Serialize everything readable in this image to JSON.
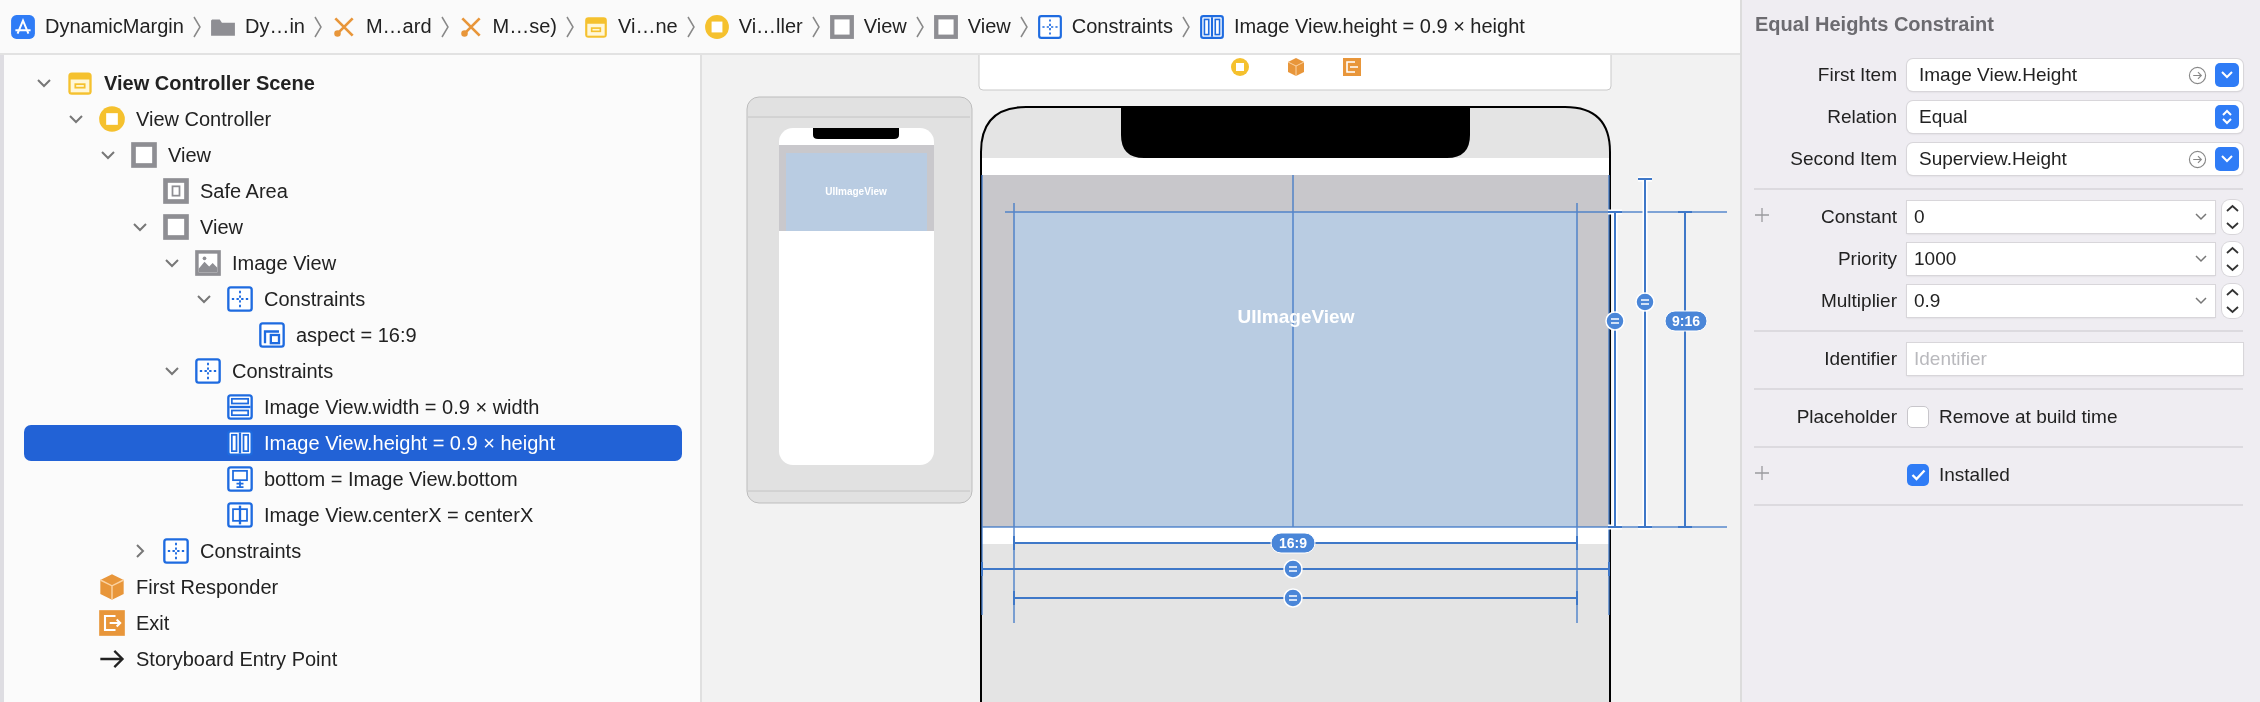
{
  "breadcrumbs": [
    {
      "label": "DynamicMargin"
    },
    {
      "label": "Dy…in"
    },
    {
      "label": "M…ard"
    },
    {
      "label": "M…se)"
    },
    {
      "label": "Vi…ne"
    },
    {
      "label": "Vi…ller"
    },
    {
      "label": "View"
    },
    {
      "label": "View"
    },
    {
      "label": "Constraints"
    },
    {
      "label": "Image View.height = 0.9 × height"
    }
  ],
  "outline": [
    {
      "label": "View Controller Scene",
      "expanded": true,
      "selected": false,
      "children": [
        {
          "label": "View Controller",
          "expanded": true,
          "selected": false,
          "children": [
            {
              "label": "View",
              "expanded": true,
              "selected": false,
              "children": [
                {
                  "label": "Safe Area",
                  "selected": false
                },
                {
                  "label": "View",
                  "expanded": true,
                  "selected": false,
                  "children": [
                    {
                      "label": "Image View",
                      "expanded": true,
                      "selected": false,
                      "children": [
                        {
                          "label": "Constraints",
                          "expanded": true,
                          "selected": false,
                          "children": [
                            {
                              "label": "aspect = 16:9",
                              "selected": false
                            }
                          ]
                        }
                      ]
                    },
                    {
                      "label": "Constraints",
                      "expanded": true,
                      "selected": false,
                      "children": [
                        {
                          "label": "Image View.width = 0.9 × width",
                          "selected": false
                        },
                        {
                          "label": "Image View.height = 0.9 × height",
                          "selected": true
                        },
                        {
                          "label": "bottom = Image View.bottom",
                          "selected": false
                        },
                        {
                          "label": "Image View.centerX = centerX",
                          "selected": false
                        }
                      ]
                    }
                  ]
                },
                {
                  "label": "Constraints",
                  "expanded": false,
                  "selected": false
                }
              ]
            }
          ]
        },
        {
          "label": "First Responder",
          "selected": false
        },
        {
          "label": "Exit",
          "selected": false
        },
        {
          "label": "Storyboard Entry Point",
          "selected": false
        }
      ]
    }
  ],
  "canvas": {
    "preview_label": "UIImageView",
    "image_view_label": "UIImageView",
    "ratio_badge": "16:9",
    "inverse_ratio_badge": "9:16"
  },
  "inspector": {
    "title": "Equal Heights Constraint",
    "sections": [
      {
        "rows": [
          {
            "kind": "item",
            "label": "First Item",
            "value": "Image View.Height",
            "variant_button": false
          },
          {
            "kind": "select",
            "label": "Relation",
            "value": "Equal",
            "variant_button": false
          },
          {
            "kind": "item",
            "label": "Second Item",
            "value": "Superview.Height",
            "variant_button": false
          }
        ]
      },
      {
        "rows": [
          {
            "kind": "combo",
            "label": "Constant",
            "value": "0",
            "variant_button": true
          },
          {
            "kind": "combo",
            "label": "Priority",
            "value": "1000",
            "variant_button": false
          },
          {
            "kind": "combo",
            "label": "Multiplier",
            "value": "0.9",
            "variant_button": false
          }
        ]
      },
      {
        "rows": [
          {
            "kind": "text",
            "label": "Identifier",
            "placeholder": "Identifier",
            "variant_button": false
          }
        ]
      },
      {
        "rows": [
          {
            "kind": "checkbox",
            "label": "Placeholder",
            "text": "Remove at build time",
            "checked": false,
            "variant_button": false
          }
        ]
      },
      {
        "rows": [
          {
            "kind": "checkbox",
            "text": "Installed",
            "checked": true,
            "variant_button": true
          }
        ]
      }
    ]
  }
}
